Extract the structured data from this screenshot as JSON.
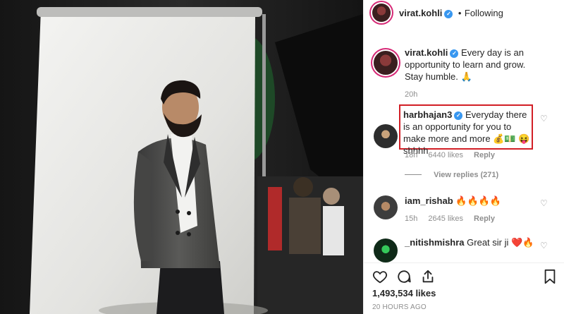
{
  "post": {
    "username": "virat.kohli",
    "follow_separator": "•",
    "follow_status": "Following"
  },
  "caption": {
    "username": "virat.kohli",
    "text": "Every day is an opportunity to learn and grow. Stay humble. 🙏",
    "time": "20h"
  },
  "comments": [
    {
      "username": "harbhajan3",
      "verified": true,
      "text": "Everyday there is an opportunity for you to make more and more 💰💵 😝 shhhh",
      "time": "18h",
      "likes": "6440 likes",
      "reply": "Reply",
      "view_replies": "View replies (271)",
      "highlighted": true
    },
    {
      "username": "iam_rishab",
      "text": "🔥🔥🔥🔥",
      "time": "15h",
      "likes": "2645 likes",
      "reply": "Reply"
    },
    {
      "username": "_nitishmishra",
      "text": "Great sir ji ❤️🔥",
      "time": "",
      "likes": "",
      "reply": ""
    }
  ],
  "likes": "1,493,534 likes",
  "timestamp": "20 HOURS AGO",
  "icons": {
    "like": "heart-icon",
    "comment": "comment-icon",
    "share": "share-icon",
    "save": "bookmark-icon",
    "comment_like": "small-heart-icon"
  },
  "colors": {
    "verified": "#3897f0",
    "highlight_box": "#d21f26",
    "story_ring": "#d62976"
  }
}
